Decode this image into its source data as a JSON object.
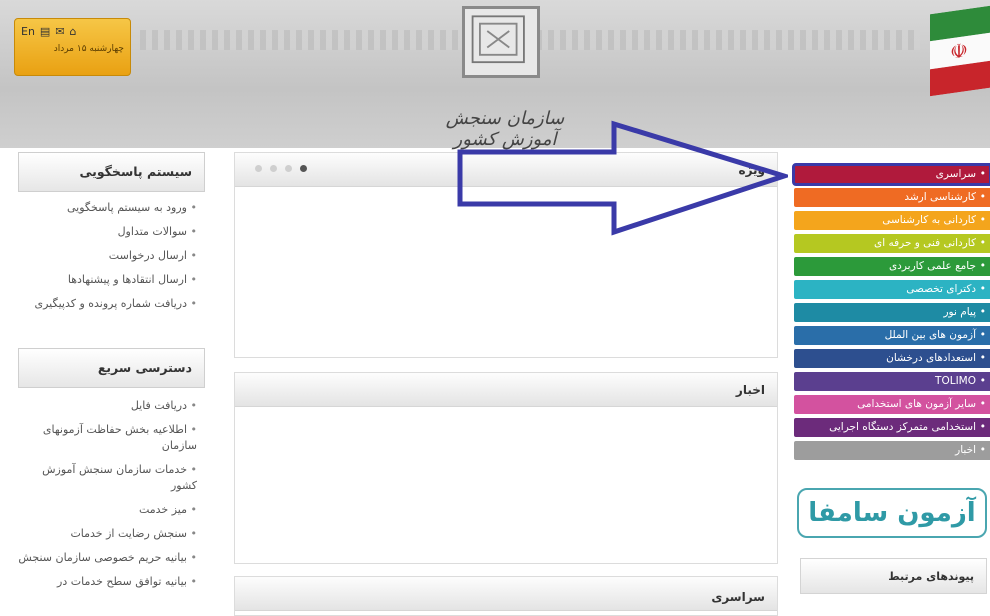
{
  "header": {
    "logo_text": "سازمان سنجش آموزش کشور",
    "top_links": [
      "En",
      "▤",
      "✉",
      "⌂"
    ],
    "date": "چهارشنبه ۱۵ مرداد"
  },
  "left_sidebar": {
    "section1_title": "سیستم پاسخگویی",
    "section1_items": [
      "ورود به سیستم پاسخگویی",
      "سوالات متداول",
      "ارسال درخواست",
      "ارسال انتقادها و پیشنهادها",
      "دریافت شماره پرونده و کدپیگیری"
    ],
    "section2_title": "دسترسی سریع",
    "section2_items": [
      "دریافت فایل",
      "اطلاعیه بخش حفاظت آزمونهای سازمان",
      "خدمات سازمان سنجش آموزش کشور",
      "میز خدمت",
      "سنجش رضایت از خدمات",
      "بیانیه حریم خصوصی سازمان سنجش",
      "بیانیه توافق سطح خدمات در"
    ]
  },
  "center": {
    "panel1_title": "ویژه",
    "panel2_title": "اخبار",
    "panel3_title": "سراسری",
    "slider_dots": 4,
    "slider_active": 4
  },
  "right_menu": {
    "items": [
      {
        "label": "سراسری",
        "color": "#b01a3c"
      },
      {
        "label": "کارشناسی ارشد",
        "color": "#ef6b23"
      },
      {
        "label": "کاردانی به کارشناسی",
        "color": "#f4a51c"
      },
      {
        "label": "کاردانی فنی و حرفه ای",
        "color": "#b5c821"
      },
      {
        "label": "جامع علمی کاربردی",
        "color": "#2c9a3a"
      },
      {
        "label": "دکترای تخصصی",
        "color": "#2cb3c3"
      },
      {
        "label": "پیام نور",
        "color": "#1e8ba4"
      },
      {
        "label": "آزمون های بین الملل",
        "color": "#2a6ea9"
      },
      {
        "label": "استعدادهای درخشان",
        "color": "#2d4f8f"
      },
      {
        "label": "TOLIMO",
        "color": "#5b3f8f"
      },
      {
        "label": "سایر آزمون های استخدامی",
        "color": "#d3529f"
      },
      {
        "label": "استخدامی متمرکز دستگاه اجرایی",
        "color": "#6c2b7b"
      },
      {
        "label": "اخبار",
        "color": "#9d9d9d"
      }
    ],
    "selected_index": 0,
    "sampa_logo": "آزمون سامفا",
    "links_title": "پیوندهای مرتبط"
  }
}
